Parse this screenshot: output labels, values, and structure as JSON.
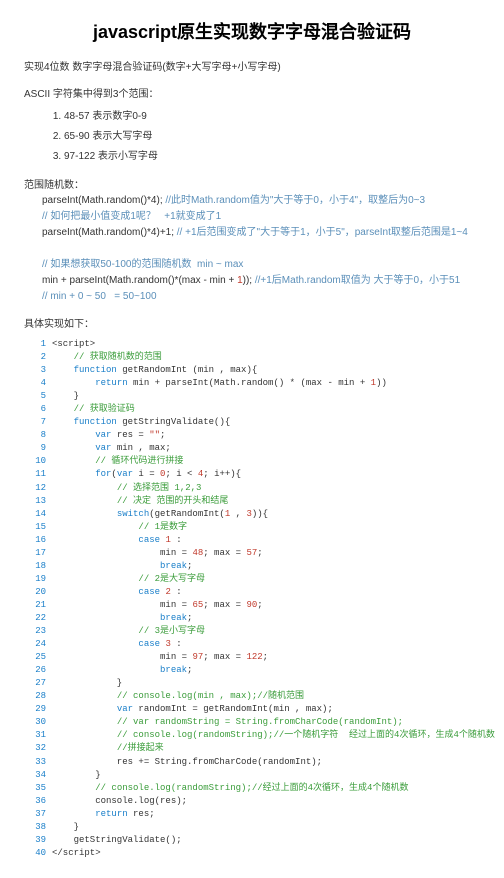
{
  "title": "javascript原生实现数字字母混合验证码",
  "intro": "实现4位数 数字字母混合验证码(数字+大写字母+小写字母)",
  "ascii_label": "ASCII 字符集中得到3个范围：",
  "ranges": [
    "48-57 表示数字0-9",
    "65-90 表示大写字母",
    "97-122 表示小写字母"
  ],
  "rand_label": "范围随机数：",
  "note1a": "parseInt(Math.random()*4); ",
  "note1b": "//此时Math.random值为\"大于等于0，小于4\"，取整后为0~3",
  "note2a": "// 如何把最小值变成1呢？   +1就变成了1",
  "note3a": "parseInt(Math.random()*4)+1; ",
  "note3b": "// +1后范围变成了\"大于等于1，小于5\"，parseInt取整后范围是1~4",
  "note4a": "// 如果想获取50-100的范围随机数  min ~ max",
  "note5a": "min + parseInt(Math.random()*(max - min + ",
  "note5b": "1",
  "note5c": ")); ",
  "note5d": "//+1后Math.random取值为 大于等于0，小于51",
  "note6a": "// min + 0 ~ 50   = 50~100",
  "result_label": "具体实现如下：",
  "code": [
    [
      {
        "t": "<script>",
        "c": "txt"
      }
    ],
    [
      {
        "t": "    ",
        "c": "txt"
      },
      {
        "t": "// 获取随机数的范围",
        "c": "cmtc"
      }
    ],
    [
      {
        "t": "    ",
        "c": "txt"
      },
      {
        "t": "function",
        "c": "kw"
      },
      {
        "t": " getRandomInt (min , max){",
        "c": "txt"
      }
    ],
    [
      {
        "t": "        ",
        "c": "txt"
      },
      {
        "t": "return",
        "c": "kw"
      },
      {
        "t": " min + parseInt(Math.random() * (max - min + ",
        "c": "txt"
      },
      {
        "t": "1",
        "c": "str"
      },
      {
        "t": "))",
        "c": "txt"
      }
    ],
    [
      {
        "t": "    }",
        "c": "txt"
      }
    ],
    [
      {
        "t": "    ",
        "c": "txt"
      },
      {
        "t": "// 获取验证码",
        "c": "cmtc"
      }
    ],
    [
      {
        "t": "    ",
        "c": "txt"
      },
      {
        "t": "function",
        "c": "kw"
      },
      {
        "t": " getStringValidate(){",
        "c": "txt"
      }
    ],
    [
      {
        "t": "        ",
        "c": "txt"
      },
      {
        "t": "var",
        "c": "kw"
      },
      {
        "t": " res = ",
        "c": "txt"
      },
      {
        "t": "\"\"",
        "c": "str"
      },
      {
        "t": ";",
        "c": "txt"
      }
    ],
    [
      {
        "t": "        ",
        "c": "txt"
      },
      {
        "t": "var",
        "c": "kw"
      },
      {
        "t": " min , max;",
        "c": "txt"
      }
    ],
    [
      {
        "t": "        ",
        "c": "txt"
      },
      {
        "t": "// 循环代码进行拼接",
        "c": "cmtc"
      }
    ],
    [
      {
        "t": "        ",
        "c": "txt"
      },
      {
        "t": "for",
        "c": "kw"
      },
      {
        "t": "(",
        "c": "txt"
      },
      {
        "t": "var",
        "c": "kw"
      },
      {
        "t": " i = ",
        "c": "txt"
      },
      {
        "t": "0",
        "c": "str"
      },
      {
        "t": "; i < ",
        "c": "txt"
      },
      {
        "t": "4",
        "c": "str"
      },
      {
        "t": "; i++){",
        "c": "txt"
      }
    ],
    [
      {
        "t": "            ",
        "c": "txt"
      },
      {
        "t": "// 选择范围 1,2,3",
        "c": "cmtc"
      }
    ],
    [
      {
        "t": "            ",
        "c": "txt"
      },
      {
        "t": "// 决定 范围的开头和结尾",
        "c": "cmtc"
      }
    ],
    [
      {
        "t": "            ",
        "c": "txt"
      },
      {
        "t": "switch",
        "c": "kw"
      },
      {
        "t": "(getRandomInt(",
        "c": "txt"
      },
      {
        "t": "1",
        "c": "str"
      },
      {
        "t": " , ",
        "c": "txt"
      },
      {
        "t": "3",
        "c": "str"
      },
      {
        "t": ")){",
        "c": "txt"
      }
    ],
    [
      {
        "t": "                ",
        "c": "txt"
      },
      {
        "t": "// 1是数字",
        "c": "cmtc"
      }
    ],
    [
      {
        "t": "                ",
        "c": "txt"
      },
      {
        "t": "case",
        "c": "kw"
      },
      {
        "t": " ",
        "c": "txt"
      },
      {
        "t": "1",
        "c": "str"
      },
      {
        "t": " :",
        "c": "txt"
      }
    ],
    [
      {
        "t": "                    min = ",
        "c": "txt"
      },
      {
        "t": "48",
        "c": "str"
      },
      {
        "t": "; max = ",
        "c": "txt"
      },
      {
        "t": "57",
        "c": "str"
      },
      {
        "t": ";",
        "c": "txt"
      }
    ],
    [
      {
        "t": "                    ",
        "c": "txt"
      },
      {
        "t": "break",
        "c": "kw"
      },
      {
        "t": ";",
        "c": "txt"
      }
    ],
    [
      {
        "t": "                ",
        "c": "txt"
      },
      {
        "t": "// 2是大写字母",
        "c": "cmtc"
      }
    ],
    [
      {
        "t": "                ",
        "c": "txt"
      },
      {
        "t": "case",
        "c": "kw"
      },
      {
        "t": " ",
        "c": "txt"
      },
      {
        "t": "2",
        "c": "str"
      },
      {
        "t": " :",
        "c": "txt"
      }
    ],
    [
      {
        "t": "                    min = ",
        "c": "txt"
      },
      {
        "t": "65",
        "c": "str"
      },
      {
        "t": "; max = ",
        "c": "txt"
      },
      {
        "t": "90",
        "c": "str"
      },
      {
        "t": ";",
        "c": "txt"
      }
    ],
    [
      {
        "t": "                    ",
        "c": "txt"
      },
      {
        "t": "break",
        "c": "kw"
      },
      {
        "t": ";",
        "c": "txt"
      }
    ],
    [
      {
        "t": "                ",
        "c": "txt"
      },
      {
        "t": "// 3是小写字母",
        "c": "cmtc"
      }
    ],
    [
      {
        "t": "                ",
        "c": "txt"
      },
      {
        "t": "case",
        "c": "kw"
      },
      {
        "t": " ",
        "c": "txt"
      },
      {
        "t": "3",
        "c": "str"
      },
      {
        "t": " :",
        "c": "txt"
      }
    ],
    [
      {
        "t": "                    min = ",
        "c": "txt"
      },
      {
        "t": "97",
        "c": "str"
      },
      {
        "t": "; max = ",
        "c": "txt"
      },
      {
        "t": "122",
        "c": "str"
      },
      {
        "t": ";",
        "c": "txt"
      }
    ],
    [
      {
        "t": "                    ",
        "c": "txt"
      },
      {
        "t": "break",
        "c": "kw"
      },
      {
        "t": ";",
        "c": "txt"
      }
    ],
    [
      {
        "t": "            }",
        "c": "txt"
      }
    ],
    [
      {
        "t": "            ",
        "c": "txt"
      },
      {
        "t": "// console.log(min , max);//随机范围",
        "c": "cmtc"
      }
    ],
    [
      {
        "t": "            ",
        "c": "txt"
      },
      {
        "t": "var",
        "c": "kw"
      },
      {
        "t": " randomInt = getRandomInt(min , max);",
        "c": "txt"
      }
    ],
    [
      {
        "t": "            ",
        "c": "txt"
      },
      {
        "t": "// var randomString = String.fromCharCode(randomInt);",
        "c": "cmtc"
      }
    ],
    [
      {
        "t": "            ",
        "c": "txt"
      },
      {
        "t": "// console.log(randomString);//一个随机字符  经过上面的4次循环，生成4个随机数",
        "c": "cmtc"
      }
    ],
    [
      {
        "t": "            ",
        "c": "txt"
      },
      {
        "t": "//拼接起来",
        "c": "cmtc"
      }
    ],
    [
      {
        "t": "            res += String.fromCharCode(randomInt);",
        "c": "txt"
      }
    ],
    [
      {
        "t": "        }",
        "c": "txt"
      }
    ],
    [
      {
        "t": "        ",
        "c": "txt"
      },
      {
        "t": "// console.log(randomString);//经过上面的4次循环，生成4个随机数",
        "c": "cmtc"
      }
    ],
    [
      {
        "t": "        console.log(res);",
        "c": "txt"
      }
    ],
    [
      {
        "t": "        ",
        "c": "txt"
      },
      {
        "t": "return",
        "c": "kw"
      },
      {
        "t": " res;",
        "c": "txt"
      }
    ],
    [
      {
        "t": "    }",
        "c": "txt"
      }
    ],
    [
      {
        "t": "    getStringValidate();",
        "c": "txt"
      }
    ],
    [
      {
        "t": "</script>",
        "c": "txt"
      }
    ]
  ]
}
